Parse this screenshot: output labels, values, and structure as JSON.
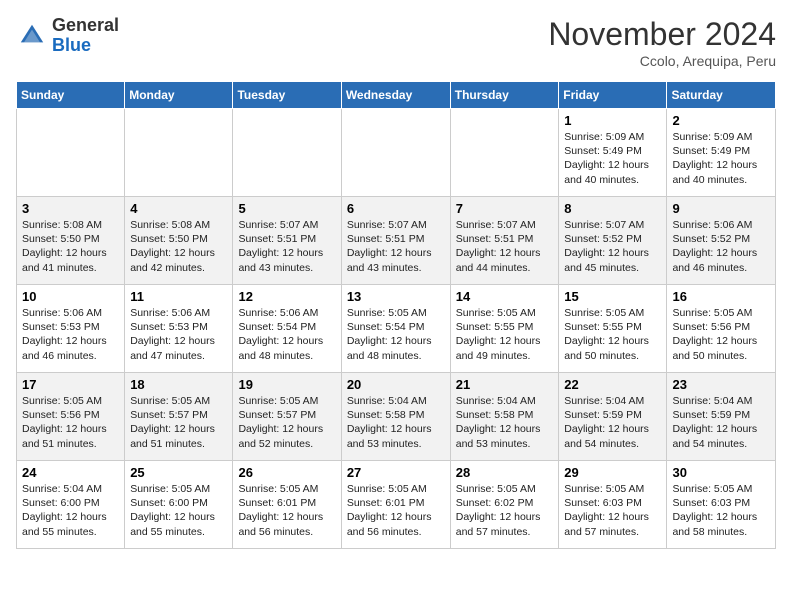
{
  "header": {
    "logo_line1": "General",
    "logo_line2": "Blue",
    "month": "November 2024",
    "location": "Ccolo, Arequipa, Peru"
  },
  "weekdays": [
    "Sunday",
    "Monday",
    "Tuesday",
    "Wednesday",
    "Thursday",
    "Friday",
    "Saturday"
  ],
  "weeks": [
    [
      {
        "day": "",
        "info": ""
      },
      {
        "day": "",
        "info": ""
      },
      {
        "day": "",
        "info": ""
      },
      {
        "day": "",
        "info": ""
      },
      {
        "day": "",
        "info": ""
      },
      {
        "day": "1",
        "info": "Sunrise: 5:09 AM\nSunset: 5:49 PM\nDaylight: 12 hours\nand 40 minutes."
      },
      {
        "day": "2",
        "info": "Sunrise: 5:09 AM\nSunset: 5:49 PM\nDaylight: 12 hours\nand 40 minutes."
      }
    ],
    [
      {
        "day": "3",
        "info": "Sunrise: 5:08 AM\nSunset: 5:50 PM\nDaylight: 12 hours\nand 41 minutes."
      },
      {
        "day": "4",
        "info": "Sunrise: 5:08 AM\nSunset: 5:50 PM\nDaylight: 12 hours\nand 42 minutes."
      },
      {
        "day": "5",
        "info": "Sunrise: 5:07 AM\nSunset: 5:51 PM\nDaylight: 12 hours\nand 43 minutes."
      },
      {
        "day": "6",
        "info": "Sunrise: 5:07 AM\nSunset: 5:51 PM\nDaylight: 12 hours\nand 43 minutes."
      },
      {
        "day": "7",
        "info": "Sunrise: 5:07 AM\nSunset: 5:51 PM\nDaylight: 12 hours\nand 44 minutes."
      },
      {
        "day": "8",
        "info": "Sunrise: 5:07 AM\nSunset: 5:52 PM\nDaylight: 12 hours\nand 45 minutes."
      },
      {
        "day": "9",
        "info": "Sunrise: 5:06 AM\nSunset: 5:52 PM\nDaylight: 12 hours\nand 46 minutes."
      }
    ],
    [
      {
        "day": "10",
        "info": "Sunrise: 5:06 AM\nSunset: 5:53 PM\nDaylight: 12 hours\nand 46 minutes."
      },
      {
        "day": "11",
        "info": "Sunrise: 5:06 AM\nSunset: 5:53 PM\nDaylight: 12 hours\nand 47 minutes."
      },
      {
        "day": "12",
        "info": "Sunrise: 5:06 AM\nSunset: 5:54 PM\nDaylight: 12 hours\nand 48 minutes."
      },
      {
        "day": "13",
        "info": "Sunrise: 5:05 AM\nSunset: 5:54 PM\nDaylight: 12 hours\nand 48 minutes."
      },
      {
        "day": "14",
        "info": "Sunrise: 5:05 AM\nSunset: 5:55 PM\nDaylight: 12 hours\nand 49 minutes."
      },
      {
        "day": "15",
        "info": "Sunrise: 5:05 AM\nSunset: 5:55 PM\nDaylight: 12 hours\nand 50 minutes."
      },
      {
        "day": "16",
        "info": "Sunrise: 5:05 AM\nSunset: 5:56 PM\nDaylight: 12 hours\nand 50 minutes."
      }
    ],
    [
      {
        "day": "17",
        "info": "Sunrise: 5:05 AM\nSunset: 5:56 PM\nDaylight: 12 hours\nand 51 minutes."
      },
      {
        "day": "18",
        "info": "Sunrise: 5:05 AM\nSunset: 5:57 PM\nDaylight: 12 hours\nand 51 minutes."
      },
      {
        "day": "19",
        "info": "Sunrise: 5:05 AM\nSunset: 5:57 PM\nDaylight: 12 hours\nand 52 minutes."
      },
      {
        "day": "20",
        "info": "Sunrise: 5:04 AM\nSunset: 5:58 PM\nDaylight: 12 hours\nand 53 minutes."
      },
      {
        "day": "21",
        "info": "Sunrise: 5:04 AM\nSunset: 5:58 PM\nDaylight: 12 hours\nand 53 minutes."
      },
      {
        "day": "22",
        "info": "Sunrise: 5:04 AM\nSunset: 5:59 PM\nDaylight: 12 hours\nand 54 minutes."
      },
      {
        "day": "23",
        "info": "Sunrise: 5:04 AM\nSunset: 5:59 PM\nDaylight: 12 hours\nand 54 minutes."
      }
    ],
    [
      {
        "day": "24",
        "info": "Sunrise: 5:04 AM\nSunset: 6:00 PM\nDaylight: 12 hours\nand 55 minutes."
      },
      {
        "day": "25",
        "info": "Sunrise: 5:05 AM\nSunset: 6:00 PM\nDaylight: 12 hours\nand 55 minutes."
      },
      {
        "day": "26",
        "info": "Sunrise: 5:05 AM\nSunset: 6:01 PM\nDaylight: 12 hours\nand 56 minutes."
      },
      {
        "day": "27",
        "info": "Sunrise: 5:05 AM\nSunset: 6:01 PM\nDaylight: 12 hours\nand 56 minutes."
      },
      {
        "day": "28",
        "info": "Sunrise: 5:05 AM\nSunset: 6:02 PM\nDaylight: 12 hours\nand 57 minutes."
      },
      {
        "day": "29",
        "info": "Sunrise: 5:05 AM\nSunset: 6:03 PM\nDaylight: 12 hours\nand 57 minutes."
      },
      {
        "day": "30",
        "info": "Sunrise: 5:05 AM\nSunset: 6:03 PM\nDaylight: 12 hours\nand 58 minutes."
      }
    ]
  ]
}
